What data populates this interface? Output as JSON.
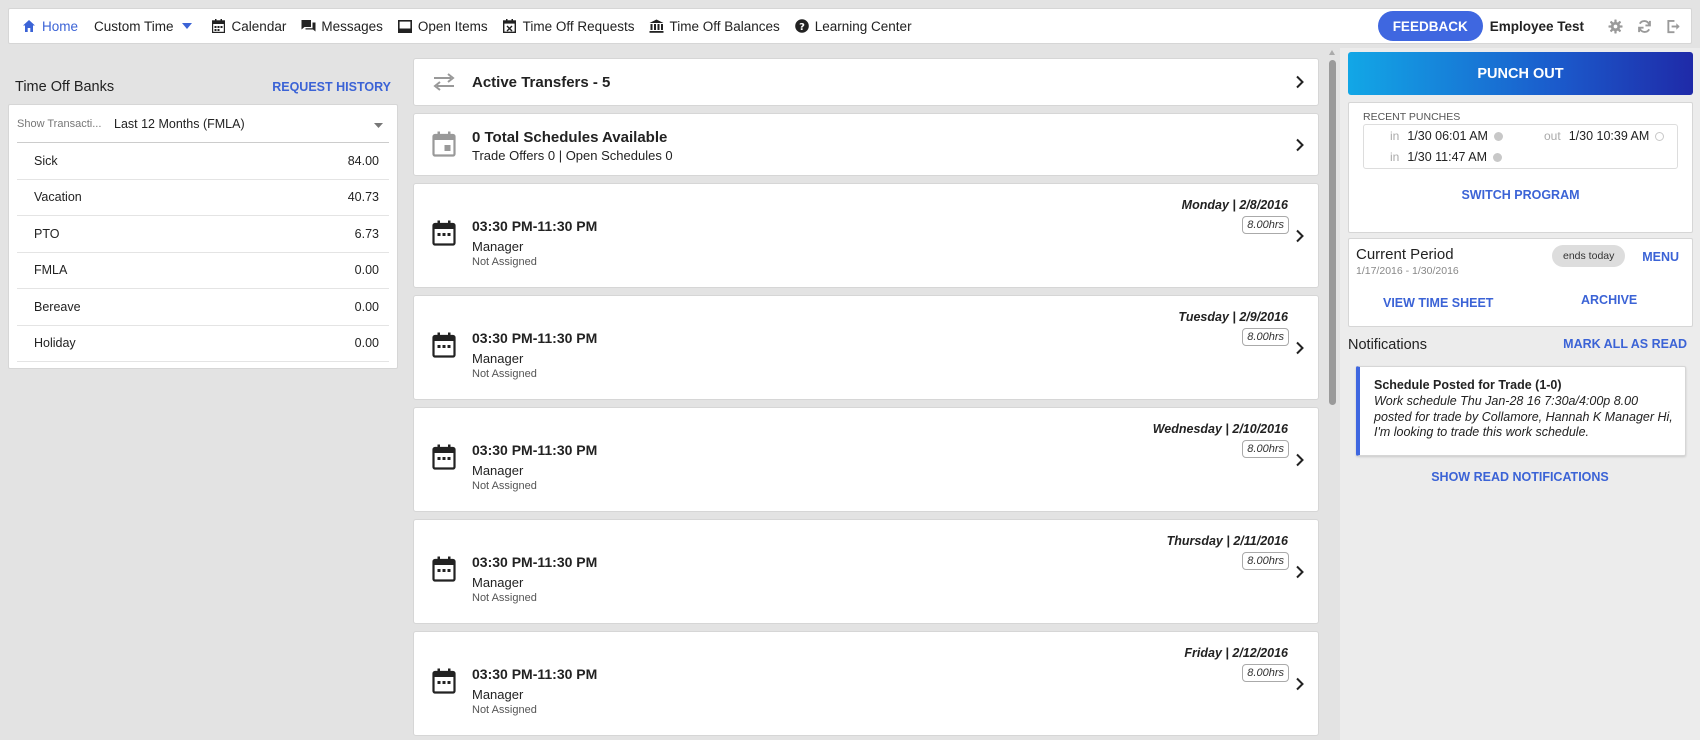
{
  "nav": {
    "items": [
      {
        "label": "Home",
        "icon": "home-icon"
      },
      {
        "label": "Custom Time",
        "icon": "chevron-down-icon"
      },
      {
        "label": "Calendar",
        "icon": "calendar-icon"
      },
      {
        "label": "Messages",
        "icon": "messages-icon"
      },
      {
        "label": "Open Items",
        "icon": "inbox-icon"
      },
      {
        "label": "Time Off Requests",
        "icon": "calendar-x-icon"
      },
      {
        "label": "Time Off Balances",
        "icon": "bank-icon"
      },
      {
        "label": "Learning Center",
        "icon": "help-icon"
      }
    ],
    "feedback_label": "FEEDBACK",
    "user_name": "Employee Test",
    "accent_color": "#3f67e0"
  },
  "time_off_banks": {
    "title": "Time Off Banks",
    "history_link": "REQUEST HISTORY",
    "filter_label": "Show Transacti...",
    "filter_value": "Last 12 Months (FMLA)",
    "banks": [
      {
        "name": "Sick",
        "value": "84.00"
      },
      {
        "name": "Vacation",
        "value": "40.73"
      },
      {
        "name": "PTO",
        "value": "6.73"
      },
      {
        "name": "FMLA",
        "value": "0.00"
      },
      {
        "name": "Bereave",
        "value": "0.00"
      },
      {
        "name": "Holiday",
        "value": "0.00"
      }
    ]
  },
  "transfers": {
    "title": "Active Transfers - 5"
  },
  "schedules_available": {
    "title": "0 Total Schedules Available",
    "subtitle": "Trade Offers 0 | Open Schedules 0"
  },
  "schedules": [
    {
      "date": "Monday | 2/8/2016",
      "hours": "8.00hrs",
      "time": "03:30 PM-11:30 PM",
      "role": "Manager",
      "assignment": "Not Assigned"
    },
    {
      "date": "Tuesday | 2/9/2016",
      "hours": "8.00hrs",
      "time": "03:30 PM-11:30 PM",
      "role": "Manager",
      "assignment": "Not Assigned"
    },
    {
      "date": "Wednesday | 2/10/2016",
      "hours": "8.00hrs",
      "time": "03:30 PM-11:30 PM",
      "role": "Manager",
      "assignment": "Not Assigned"
    },
    {
      "date": "Thursday | 2/11/2016",
      "hours": "8.00hrs",
      "time": "03:30 PM-11:30 PM",
      "role": "Manager",
      "assignment": "Not Assigned"
    },
    {
      "date": "Friday | 2/12/2016",
      "hours": "8.00hrs",
      "time": "03:30 PM-11:30 PM",
      "role": "Manager",
      "assignment": "Not Assigned"
    }
  ],
  "punch": {
    "button_label": "PUNCH OUT",
    "recent_label": "RECENT PUNCHES",
    "punches": [
      {
        "direction": "in",
        "time": "1/30 06:01 AM"
      },
      {
        "direction": "out",
        "time": "1/30 10:39 AM"
      },
      {
        "direction": "in",
        "time": "1/30 11:47 AM"
      }
    ],
    "switch_label": "SWITCH PROGRAM"
  },
  "period": {
    "title": "Current Period",
    "range": "1/17/2016 - 1/30/2016",
    "badge": "ends today",
    "menu_label": "MENU",
    "timesheet_label": "VIEW TIME SHEET",
    "archive_label": "ARCHIVE"
  },
  "notifications": {
    "title": "Notifications",
    "mark_all_label": "MARK ALL AS READ",
    "items": [
      {
        "heading": "Schedule Posted for Trade (1-0)",
        "body": "Work schedule Thu Jan-28 16 7:30a/4:00p 8.00 posted for trade by Collamore, Hannah K Manager Hi, I'm looking to trade this work schedule."
      }
    ],
    "show_read_label": "SHOW READ NOTIFICATIONS"
  }
}
